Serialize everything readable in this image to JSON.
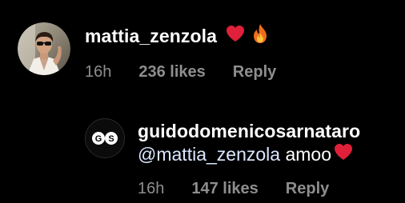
{
  "colors": {
    "background": "#000000",
    "text": "#ffffff",
    "meta": "#8e8e8e",
    "heart": "#e0203a"
  },
  "comment": {
    "username": "mattia_zenzola",
    "emojis": [
      "heart-icon",
      "fire-icon"
    ],
    "time": "16h",
    "likes": "236 likes",
    "reply_label": "Reply"
  },
  "reply": {
    "username": "guidodomenicosarnataro",
    "mention": "@mattia_zenzola",
    "text": " amoo",
    "emojis": [
      "heart-icon"
    ],
    "time": "16h",
    "likes": "147 likes",
    "reply_label": "Reply"
  }
}
